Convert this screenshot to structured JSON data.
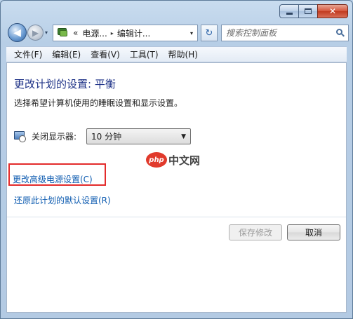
{
  "window": {
    "minimize_icon": "minimize-icon",
    "maximize_icon": "maximize-icon",
    "close_glyph": "✕"
  },
  "nav": {
    "back_glyph": "◀",
    "forward_glyph": "▶",
    "history_glyph": "▾",
    "address": {
      "prefix": "«",
      "segments": [
        "电源...",
        "编辑计..."
      ],
      "separator": "▸",
      "dropdown_glyph": "▾"
    },
    "refresh_glyph": "↻",
    "search_placeholder": "搜索控制面板"
  },
  "menu": {
    "items": [
      "文件(F)",
      "编辑(E)",
      "查看(V)",
      "工具(T)",
      "帮助(H)"
    ]
  },
  "main": {
    "title": "更改计划的设置: 平衡",
    "description": "选择希望计算机使用的睡眠设置和显示设置。",
    "display_off_label": "关闭显示器:",
    "display_off_value": "10 分钟",
    "select_arrow": "▼",
    "watermark_logo": "php",
    "watermark_text": "中文网",
    "advanced_link": "更改高级电源设置(C)",
    "restore_link": "还原此计划的默认设置(R)",
    "save_button": "保存修改",
    "cancel_button": "取消"
  },
  "colors": {
    "title_blue": "#1e3287",
    "link_blue": "#0d5bb0",
    "highlight_red": "#e32b2b"
  }
}
